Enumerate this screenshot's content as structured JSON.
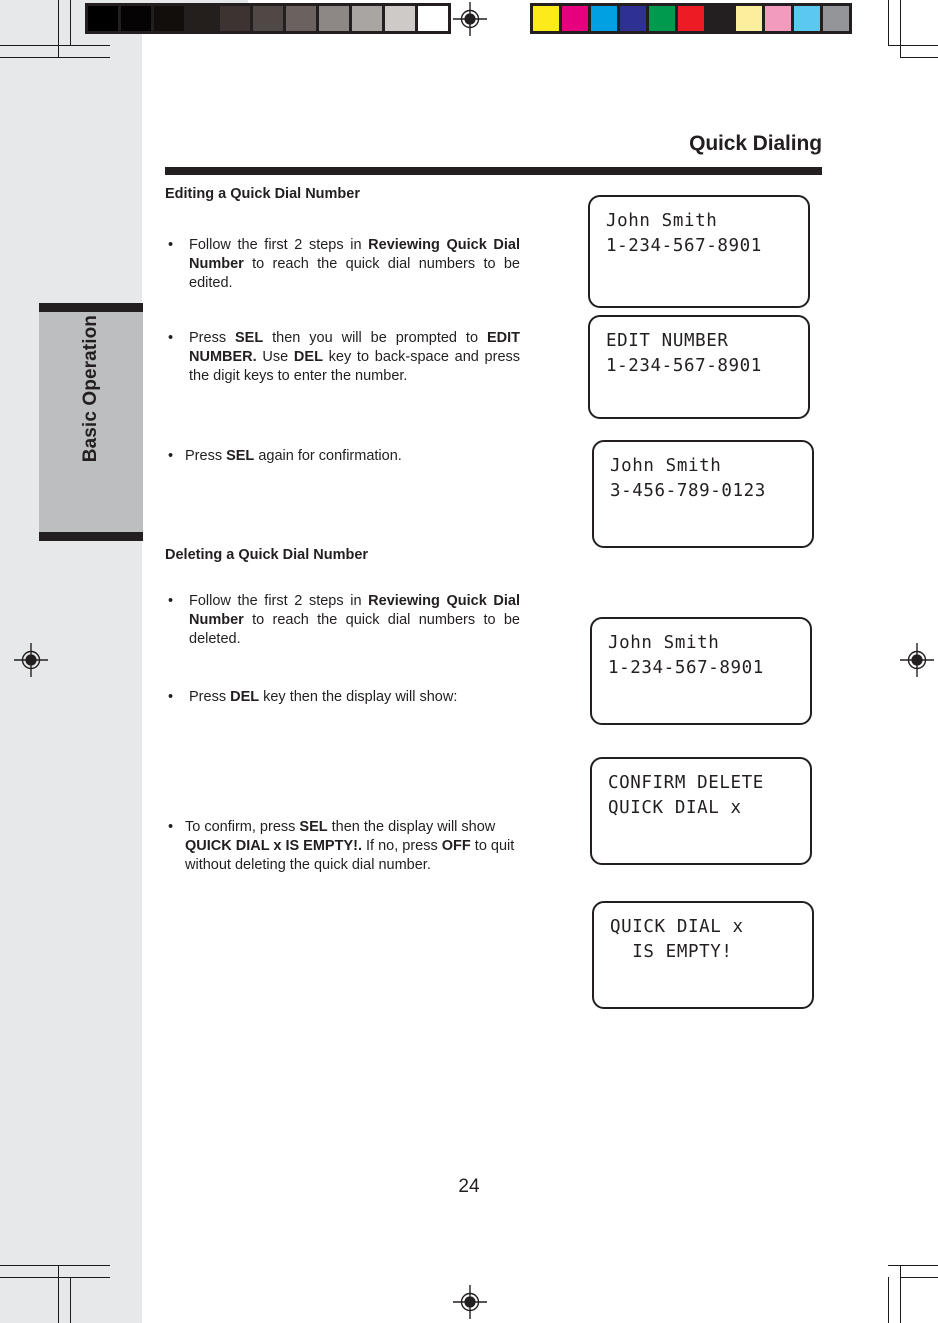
{
  "document": {
    "page_title": "Quick Dialing",
    "page_number": "24",
    "side_tab_label": "Basic Operation"
  },
  "prepress": {
    "grayscale_wedge": [
      "#000000",
      "#050303",
      "#120e0c",
      "#241f1d",
      "#3d3431",
      "#504845",
      "#6b625f",
      "#8d8785",
      "#a9a5a2",
      "#cdcac7",
      "#ffffff"
    ],
    "color_bar": [
      "#fcea1b",
      "#e6007e",
      "#00a0e3",
      "#2e3192",
      "#009a4e",
      "#ed1c24",
      "#231f20",
      "#fbee9c",
      "#f39bbf",
      "#5bc8f2",
      "#939598"
    ],
    "registration_icon": "registration-target-icon"
  },
  "sections": [
    {
      "heading": "Editing a Quick Dial Number",
      "bullets": [
        {
          "id": "edit-step-1",
          "runs": [
            {
              "t": "Follow the first 2 steps in ",
              "b": false
            },
            {
              "t": "Reviewing Quick Dial Number",
              "b": true
            },
            {
              "t": " to reach the quick dial numbers to be edited.",
              "b": false
            }
          ]
        },
        {
          "id": "edit-step-2",
          "runs": [
            {
              "t": "Press ",
              "b": false
            },
            {
              "t": "SEL",
              "b": true
            },
            {
              "t": " then you will be prompted to ",
              "b": false
            },
            {
              "t": "EDIT NUMBER.",
              "b": true
            },
            {
              "t": " Use ",
              "b": false
            },
            {
              "t": "DEL",
              "b": true
            },
            {
              "t": " key to back-space and press the digit keys to enter the number.",
              "b": false
            }
          ]
        },
        {
          "id": "edit-step-3",
          "runs": [
            {
              "t": "Press ",
              "b": false
            },
            {
              "t": "SEL",
              "b": true
            },
            {
              "t": " again for confirmation.",
              "b": false
            }
          ]
        }
      ]
    },
    {
      "heading": "Deleting a Quick Dial Number",
      "bullets": [
        {
          "id": "delete-step-1",
          "runs": [
            {
              "t": " Follow the first 2 steps in ",
              "b": false
            },
            {
              "t": "Reviewing Quick Dial Number",
              "b": true
            },
            {
              "t": " to reach the quick dial numbers to be deleted.",
              "b": false
            }
          ]
        },
        {
          "id": "delete-step-2",
          "runs": [
            {
              "t": "Press ",
              "b": false
            },
            {
              "t": "DEL",
              "b": true
            },
            {
              "t": " key then the display will show:",
              "b": false
            }
          ]
        },
        {
          "id": "delete-step-3",
          "runs": [
            {
              "t": "To confirm, press ",
              "b": false
            },
            {
              "t": "SEL",
              "b": true
            },
            {
              "t": " then the display will show ",
              "b": false
            },
            {
              "t": "QUICK DIAL x IS EMPTY!.",
              "b": true
            },
            {
              "t": "  If no, press ",
              "b": false
            },
            {
              "t": "OFF",
              "b": true
            },
            {
              "t": " to quit without deleting the quick dial number.",
              "b": false
            }
          ]
        }
      ]
    }
  ],
  "displays": [
    {
      "id": "lcd-contact-original",
      "line1": "John Smith",
      "line2": "1-234-567-8901"
    },
    {
      "id": "lcd-edit-number",
      "line1": "EDIT NUMBER",
      "line2": "1-234-567-8901"
    },
    {
      "id": "lcd-contact-edited",
      "line1": "John Smith",
      "line2": "3-456-789-0123"
    },
    {
      "id": "lcd-contact-delete",
      "line1": "John Smith",
      "line2": "1-234-567-8901"
    },
    {
      "id": "lcd-confirm-delete",
      "line1": "CONFIRM DELETE",
      "line2": "QUICK DIAL x"
    },
    {
      "id": "lcd-empty-result",
      "line1": "QUICK DIAL x",
      "line2": "  IS EMPTY!"
    }
  ]
}
